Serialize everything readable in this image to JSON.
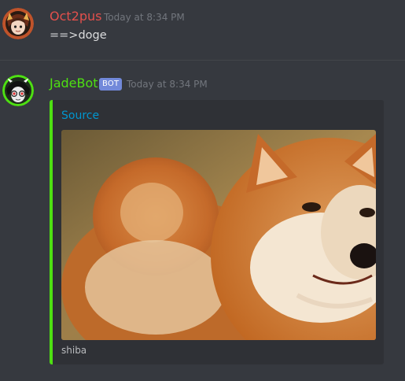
{
  "messages": [
    {
      "username": "Oct2pus",
      "username_color": "#e2504c",
      "timestamp": "Today at 8:34 PM",
      "content": "==>doge"
    },
    {
      "username": "JadeBot",
      "username_color": "#4ee012",
      "bot_tag": "BOT",
      "timestamp": "Today at 8:34 PM",
      "embed": {
        "title": "Source",
        "accent_color": "#4ee012",
        "footer": "shiba",
        "image_icon": "shiba-inu-photo"
      }
    }
  ]
}
